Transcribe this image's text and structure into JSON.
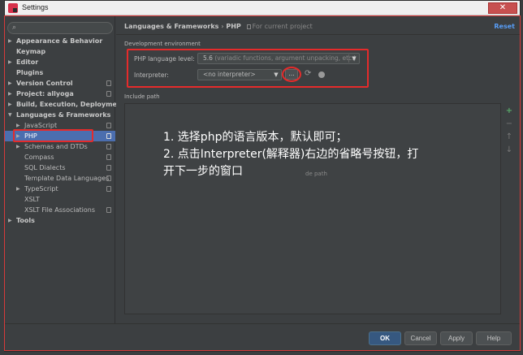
{
  "window": {
    "title": "Settings",
    "close_glyph": "✕"
  },
  "sidebar": {
    "search_placeholder": "",
    "tree": [
      {
        "label": "Appearance & Behavior",
        "level": 0,
        "expanded": false,
        "bold": true,
        "selected": false,
        "project_icon": false
      },
      {
        "label": "Keymap",
        "level": 0,
        "leaf": true,
        "bold": true,
        "selected": false,
        "project_icon": false
      },
      {
        "label": "Editor",
        "level": 0,
        "expanded": false,
        "bold": true,
        "selected": false,
        "project_icon": false
      },
      {
        "label": "Plugins",
        "level": 0,
        "leaf": true,
        "bold": true,
        "selected": false,
        "project_icon": false
      },
      {
        "label": "Version Control",
        "level": 0,
        "expanded": false,
        "bold": true,
        "selected": false,
        "project_icon": true
      },
      {
        "label": "Project: allyoga",
        "level": 0,
        "expanded": false,
        "bold": true,
        "selected": false,
        "project_icon": true
      },
      {
        "label": "Build, Execution, Deployment",
        "level": 0,
        "expanded": false,
        "bold": true,
        "selected": false,
        "project_icon": false
      },
      {
        "label": "Languages & Frameworks",
        "level": 0,
        "expanded": true,
        "bold": true,
        "selected": false,
        "project_icon": false
      },
      {
        "label": "JavaScript",
        "level": 1,
        "expanded": false,
        "bold": false,
        "selected": false,
        "project_icon": true
      },
      {
        "label": "PHP",
        "level": 1,
        "expanded": false,
        "bold": false,
        "selected": true,
        "project_icon": true
      },
      {
        "label": "Schemas and DTDs",
        "level": 1,
        "expanded": false,
        "bold": false,
        "selected": false,
        "project_icon": true
      },
      {
        "label": "Compass",
        "level": 1,
        "leaf": true,
        "bold": false,
        "selected": false,
        "project_icon": true
      },
      {
        "label": "SQL Dialects",
        "level": 1,
        "leaf": true,
        "bold": false,
        "selected": false,
        "project_icon": true
      },
      {
        "label": "Template Data Languages",
        "level": 1,
        "leaf": true,
        "bold": false,
        "selected": false,
        "project_icon": true
      },
      {
        "label": "TypeScript",
        "level": 1,
        "expanded": false,
        "bold": false,
        "selected": false,
        "project_icon": true
      },
      {
        "label": "XSLT",
        "level": 1,
        "leaf": true,
        "bold": false,
        "selected": false,
        "project_icon": false
      },
      {
        "label": "XSLT File Associations",
        "level": 1,
        "leaf": true,
        "bold": false,
        "selected": false,
        "project_icon": true
      },
      {
        "label": "Tools",
        "level": 0,
        "expanded": false,
        "bold": true,
        "selected": false,
        "project_icon": false
      }
    ]
  },
  "content": {
    "breadcrumb": {
      "parent": "Languages & Frameworks",
      "separator": "›",
      "current": "PHP",
      "scope": "For current project"
    },
    "reset_label": "Reset",
    "dev_env_title": "Development environment",
    "php_level_label": "PHP language level:",
    "php_level_value": "5.6",
    "php_level_detail": "(variadic functions, argument unpacking, etc.)",
    "interpreter_label": "Interpreter:",
    "interpreter_value": "<no interpreter>",
    "ellipsis_label": "...",
    "include_path_title": "Include path",
    "include_empty_hint": "de path",
    "side_toolbar": [
      "+",
      "−",
      "↑",
      "↓"
    ]
  },
  "annotation": {
    "line1": "1. 选择php的语言版本，默认即可；",
    "line2": "2. 点击Interpreter(解释器)右边的省略号按钮，打开下一步的窗口"
  },
  "footer": {
    "ok": "OK",
    "cancel": "Cancel",
    "apply": "Apply",
    "help": "Help"
  },
  "colors": {
    "accent": "#4b6eaf",
    "highlight": "#e52b2b",
    "link": "#589df6",
    "background": "#3c3f41"
  }
}
